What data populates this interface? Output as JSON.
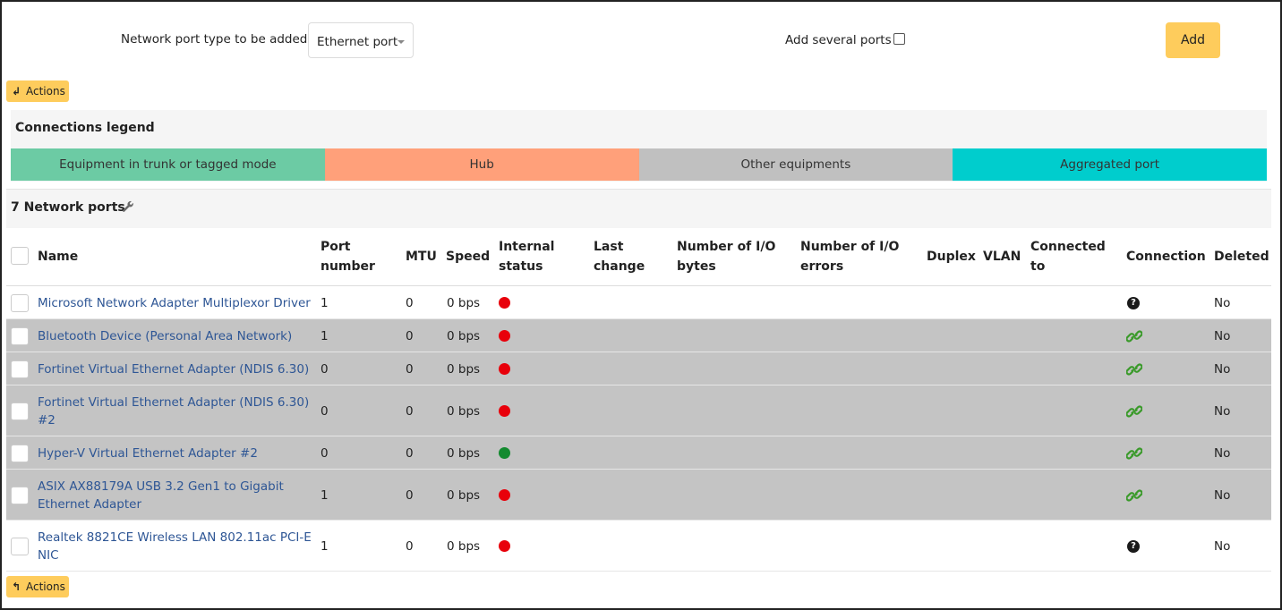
{
  "form": {
    "type_label": "Network port type to be added",
    "type_value": "Ethernet port",
    "several_label": "Add several ports",
    "add_label": "Add"
  },
  "actions": {
    "label": "Actions"
  },
  "legend": {
    "title": "Connections legend",
    "items": [
      {
        "label": "Equipment in trunk or tagged mode",
        "color": "#6ccba4"
      },
      {
        "label": "Hub",
        "color": "#ffa07a"
      },
      {
        "label": "Other equipments",
        "color": "#c0c0c0"
      },
      {
        "label": "Aggregated port",
        "color": "#00cdcd"
      }
    ]
  },
  "ports": {
    "title": "7 Network ports",
    "columns": {
      "name": "Name",
      "port_number": [
        "Port",
        "number"
      ],
      "mtu": "MTU",
      "speed": "Speed",
      "internal_status": [
        "Internal",
        "status"
      ],
      "last_change": [
        "Last",
        "change"
      ],
      "io_bytes": [
        "Number of I/O",
        "bytes"
      ],
      "io_errors": [
        "Number of I/O",
        "errors"
      ],
      "duplex": "Duplex",
      "vlan": "VLAN",
      "connected_to": [
        "Connected",
        "to"
      ],
      "connection": "Connection",
      "deleted": "Deleted"
    },
    "rows": [
      {
        "name": "Microsoft Network Adapter Multiplexor Driver",
        "port": "1",
        "mtu": "0",
        "speed": "0 bps",
        "status": "red",
        "connection": "unknown",
        "deleted": "No"
      },
      {
        "name": "Bluetooth Device (Personal Area Network)",
        "port": "1",
        "mtu": "0",
        "speed": "0 bps",
        "status": "red",
        "connection": "link",
        "deleted": "No"
      },
      {
        "name": "Fortinet Virtual Ethernet Adapter (NDIS 6.30)",
        "port": "0",
        "mtu": "0",
        "speed": "0 bps",
        "status": "red",
        "connection": "link",
        "deleted": "No"
      },
      {
        "name": "Fortinet Virtual Ethernet Adapter (NDIS 6.30) #2",
        "port": "0",
        "mtu": "0",
        "speed": "0 bps",
        "status": "red",
        "connection": "link",
        "deleted": "No"
      },
      {
        "name": "Hyper-V Virtual Ethernet Adapter #2",
        "port": "0",
        "mtu": "0",
        "speed": "0 bps",
        "status": "green",
        "connection": "link",
        "deleted": "No"
      },
      {
        "name": "ASIX AX88179A USB 3.2 Gen1 to Gigabit Ethernet Adapter",
        "port": "1",
        "mtu": "0",
        "speed": "0 bps",
        "status": "red",
        "connection": "link",
        "deleted": "No"
      },
      {
        "name": "Realtek 8821CE Wireless LAN 802.11ac PCI-E NIC",
        "port": "1",
        "mtu": "0",
        "speed": "0 bps",
        "status": "red",
        "connection": "unknown",
        "deleted": "No"
      }
    ]
  },
  "colors": {
    "status_red": "#e8000b",
    "status_green": "#138a2f",
    "link_green": "#3a9a2a",
    "gray_row": "#c4c4c4"
  }
}
